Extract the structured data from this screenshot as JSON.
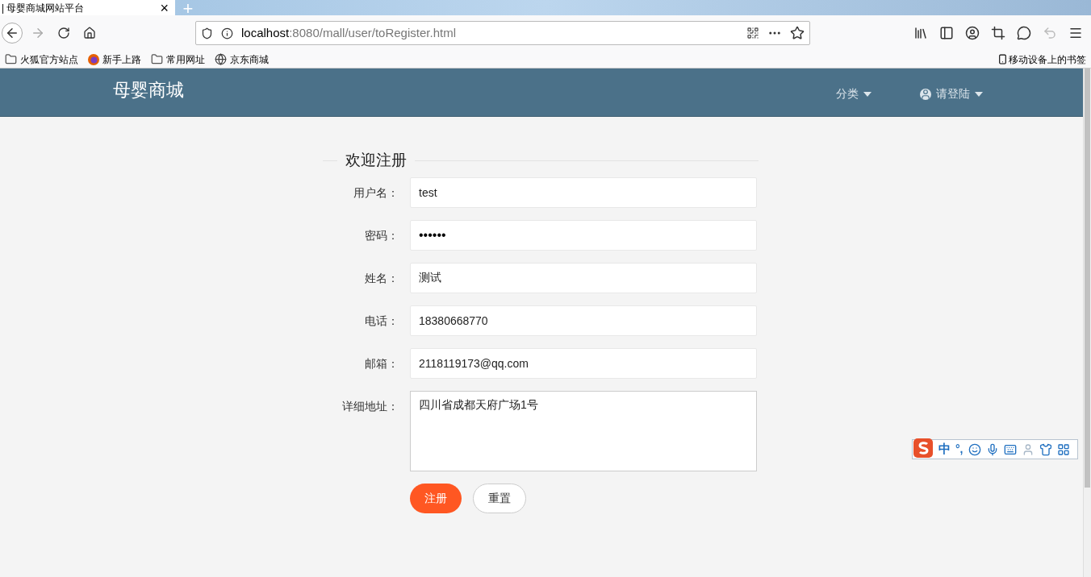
{
  "browser": {
    "tab": {
      "title": "| 母婴商城网站平台",
      "close": "×"
    },
    "new_tab": "+",
    "url": {
      "host": "localhost",
      "path": ":8080/mall/user/toRegister.html"
    },
    "bookmarks": [
      {
        "label": "火狐官方站点",
        "kind": "folder"
      },
      {
        "label": "新手上路",
        "kind": "firefox"
      },
      {
        "label": "常用网址",
        "kind": "folder"
      },
      {
        "label": "京东商城",
        "kind": "globe"
      }
    ],
    "mobile_bookmarks": "移动设备上的书签"
  },
  "site": {
    "brand": "母婴商城",
    "nav": [
      {
        "label": "分类",
        "kind": "menu"
      },
      {
        "label": "请登陆",
        "kind": "user"
      }
    ]
  },
  "form": {
    "title": "欢迎注册",
    "fields": [
      {
        "label": "用户名：",
        "value": "test",
        "kind": "input"
      },
      {
        "label": "密码：",
        "value": "••••••",
        "kind": "password"
      },
      {
        "label": "姓名：",
        "value": "测试",
        "kind": "input"
      },
      {
        "label": "电话：",
        "value": "18380668770",
        "kind": "input"
      },
      {
        "label": "邮箱：",
        "value": "2118119173@qq.com",
        "kind": "input"
      },
      {
        "label": "详细地址：",
        "value": "四川省成都天府广场1号",
        "kind": "textarea"
      }
    ],
    "buttons": [
      {
        "label": "注册",
        "kind": "primary"
      },
      {
        "label": "重置",
        "kind": "secondary"
      }
    ]
  },
  "ime": {
    "mode": "中",
    "punct": "°,"
  }
}
